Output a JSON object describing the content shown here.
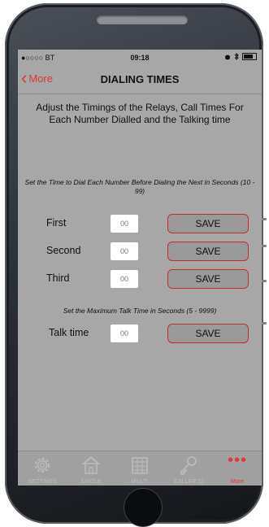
{
  "status_bar": {
    "carrier": "●○○○○ BT",
    "time": "09:18"
  },
  "nav": {
    "back_label": "More",
    "title": "DIALING TIMES"
  },
  "intro": "Adjust the Timings of the Relays, Call Times For Each Number Dialled and the Talking time",
  "dial_hint": "Set the Time to Dial Each Number Before Dialing the Next in Seconds (10 - 99)",
  "talk_hint": "Set the Maximum Talk Time in Seconds (5 - 9999)",
  "rows": [
    {
      "label": "First",
      "placeholder": "00",
      "button": "SAVE"
    },
    {
      "label": "Second",
      "placeholder": "00",
      "button": "SAVE"
    },
    {
      "label": "Third",
      "placeholder": "00",
      "button": "SAVE"
    },
    {
      "label": "Talk time",
      "placeholder": "00",
      "button": "SAVE"
    }
  ],
  "tabs": [
    {
      "label": "SETTINGS",
      "icon": "gear-icon"
    },
    {
      "label": "SINGLE",
      "icon": "house-icon"
    },
    {
      "label": "MULTI",
      "icon": "building-icon"
    },
    {
      "label": "CALLER ID",
      "icon": "key-icon"
    },
    {
      "label": "More",
      "icon": "more-dots-icon",
      "active": true
    }
  ],
  "colors": {
    "accent": "#d93a3a",
    "screen_bg": "#a7a7a7",
    "button_bg": "#9a9a9a"
  }
}
